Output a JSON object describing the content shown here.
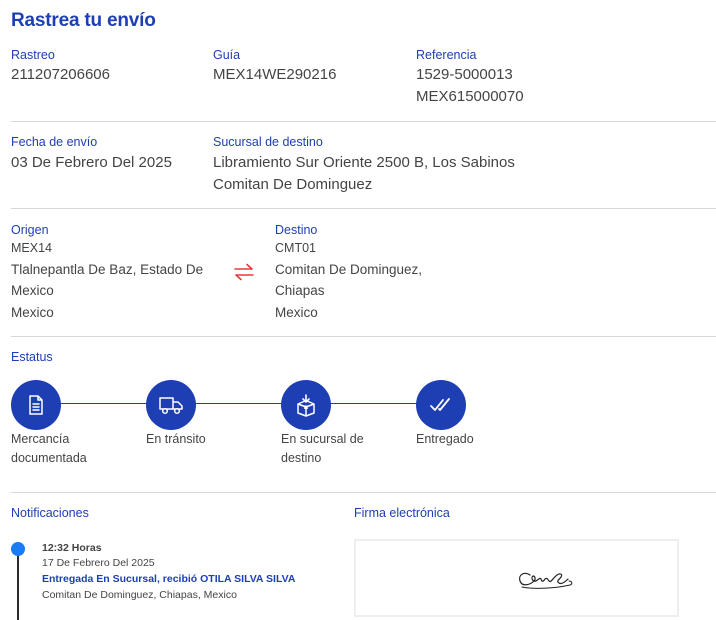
{
  "title": "Rastrea tu envío",
  "info": {
    "rastreo_label": "Rastreo",
    "rastreo_value": "211207206606",
    "guia_label": "Guía",
    "guia_value": "MEX14WE290216",
    "referencia_label": "Referencia",
    "referencia_line1": "1529-5000013",
    "referencia_line2": "MEX615000070",
    "fecha_label": "Fecha de envío",
    "fecha_value": "03 De Febrero Del 2025",
    "sucursal_label": "Sucursal de destino",
    "sucursal_line1": "Libramiento Sur Oriente 2500 B, Los Sabinos",
    "sucursal_line2": "Comitan De Dominguez"
  },
  "route": {
    "origen_label": "Origen",
    "origen_code": "MEX14",
    "origen_line1": "Tlalnepantla De Baz, Estado De",
    "origen_line2": "Mexico",
    "origen_country": "Mexico",
    "destino_label": "Destino",
    "destino_code": "CMT01",
    "destino_line1": "Comitan De Dominguez,",
    "destino_line2": "Chiapas",
    "destino_country": "Mexico",
    "swap_icon": "swap-arrows-icon",
    "swap_color": "#e53935"
  },
  "status": {
    "label": "Estatus",
    "steps": [
      {
        "line1": "Mercancía",
        "line2": "documentada",
        "icon": "document-icon"
      },
      {
        "line1": "En tránsito",
        "line2": "",
        "icon": "truck-icon"
      },
      {
        "line1": "En sucursal de",
        "line2": "destino",
        "icon": "package-icon"
      },
      {
        "line1": "Entregado",
        "line2": "",
        "icon": "double-check-icon"
      }
    ]
  },
  "notifications": {
    "label": "Notificaciones",
    "items": [
      {
        "time": "12:32 Horas",
        "date": "17 De Febrero Del 2025",
        "status": "Entregada En Sucursal, recibió OTILA SILVA SILVA",
        "location": "Comitan De Dominguez, Chiapas, Mexico"
      }
    ]
  },
  "signature": {
    "label": "Firma electrónica"
  },
  "colors": {
    "accent": "#1e3fb4",
    "dot": "#1a7cf5",
    "divider": "#d8d8d8"
  }
}
